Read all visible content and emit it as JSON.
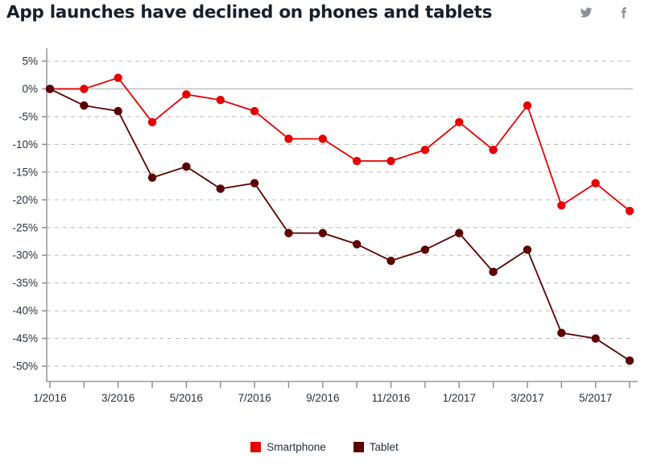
{
  "header": {
    "title": "App launches have declined on phones and tablets",
    "social": [
      {
        "name": "twitter-icon",
        "label": "Twitter"
      },
      {
        "name": "facebook-icon",
        "label": "Facebook"
      }
    ]
  },
  "legend": {
    "items": [
      {
        "label": "Smartphone",
        "color": "#e60000"
      },
      {
        "label": "Tablet",
        "color": "#5c0000"
      }
    ]
  },
  "chart_data": {
    "type": "line",
    "title": "App launches have declined on phones and tablets",
    "xlabel": "",
    "ylabel": "",
    "ylim": [
      -50,
      5
    ],
    "ytick_labels": [
      "5%",
      "0%",
      "-5%",
      "-10%",
      "-15%",
      "-20%",
      "-25%",
      "-30%",
      "-35%",
      "-40%",
      "-45%",
      "-50%"
    ],
    "ytick_values": [
      5,
      0,
      -5,
      -10,
      -15,
      -20,
      -25,
      -30,
      -35,
      -40,
      -45,
      -50
    ],
    "grid": true,
    "legend_position": "bottom",
    "x": [
      "1/2016",
      "2/2016",
      "3/2016",
      "4/2016",
      "5/2016",
      "6/2016",
      "7/2016",
      "8/2016",
      "9/2016",
      "10/2016",
      "11/2016",
      "12/2016",
      "1/2017",
      "2/2017",
      "3/2017",
      "4/2017",
      "5/2017",
      "6/2017"
    ],
    "xtick_labels": [
      "1/2016",
      "3/2016",
      "5/2016",
      "7/2016",
      "9/2016",
      "11/2016",
      "1/2017",
      "3/2017",
      "5/2017"
    ],
    "xtick_indices": [
      0,
      2,
      4,
      6,
      8,
      10,
      12,
      14,
      16
    ],
    "series": [
      {
        "name": "Smartphone",
        "color": "#e60000",
        "values": [
          0,
          0,
          2,
          -6,
          -1,
          -2,
          -4,
          -9,
          -9,
          -13,
          -13,
          -11,
          -6,
          -11,
          -3,
          -21,
          -17,
          -22
        ]
      },
      {
        "name": "Tablet",
        "color": "#5c0000",
        "values": [
          0,
          -3,
          -4,
          -16,
          -14,
          -18,
          -17,
          -26,
          -26,
          -28,
          -31,
          -29,
          -26,
          -33,
          -29,
          -44,
          -45,
          -49
        ]
      }
    ]
  }
}
